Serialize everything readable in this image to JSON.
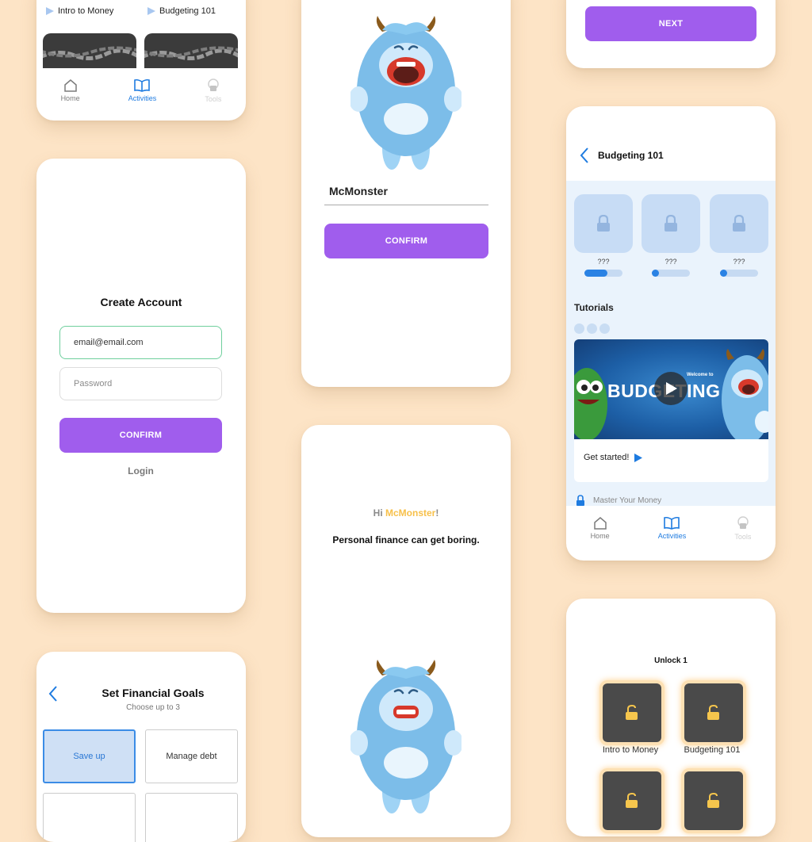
{
  "colors": {
    "background": "#fde4c6",
    "accent": "#a05ded",
    "blue": "#1e7be0",
    "highlight": "#f7c04a"
  },
  "nav": {
    "home": "Home",
    "activities": "Activities",
    "tools": "Tools"
  },
  "screen_courses_top": {
    "course1": "Intro to Money",
    "course2": "Budgeting 101"
  },
  "screen_create_account": {
    "title": "Create Account",
    "email_value": "email@email.com",
    "password_placeholder": "Password",
    "confirm_label": "CONFIRM",
    "login_label": "Login"
  },
  "screen_goals": {
    "title": "Set Financial Goals",
    "subtitle": "Choose up to 3",
    "options": [
      "Save up",
      "Manage debt"
    ]
  },
  "screen_name": {
    "name_value": "McMonster",
    "confirm_label": "CONFIRM"
  },
  "screen_intro": {
    "greeting_prefix": "Hi ",
    "greeting_name": "McMonster",
    "greeting_suffix": "!",
    "message": "Personal finance can get boring."
  },
  "screen_next": {
    "next_label": "NEXT"
  },
  "screen_budgeting": {
    "title": "Budgeting 101",
    "locked_labels": [
      "???",
      "???",
      "???"
    ],
    "progress": [
      0.6,
      0.15,
      0.15
    ],
    "tutorials_heading": "Tutorials",
    "video_welcome": "Welcome to",
    "video_title": "BUDGETING",
    "get_started": "Get started!",
    "next_item": "Master Your Money"
  },
  "screen_unlock": {
    "title": "Unlock 1",
    "courses": [
      "Intro to Money",
      "Budgeting 101"
    ]
  }
}
